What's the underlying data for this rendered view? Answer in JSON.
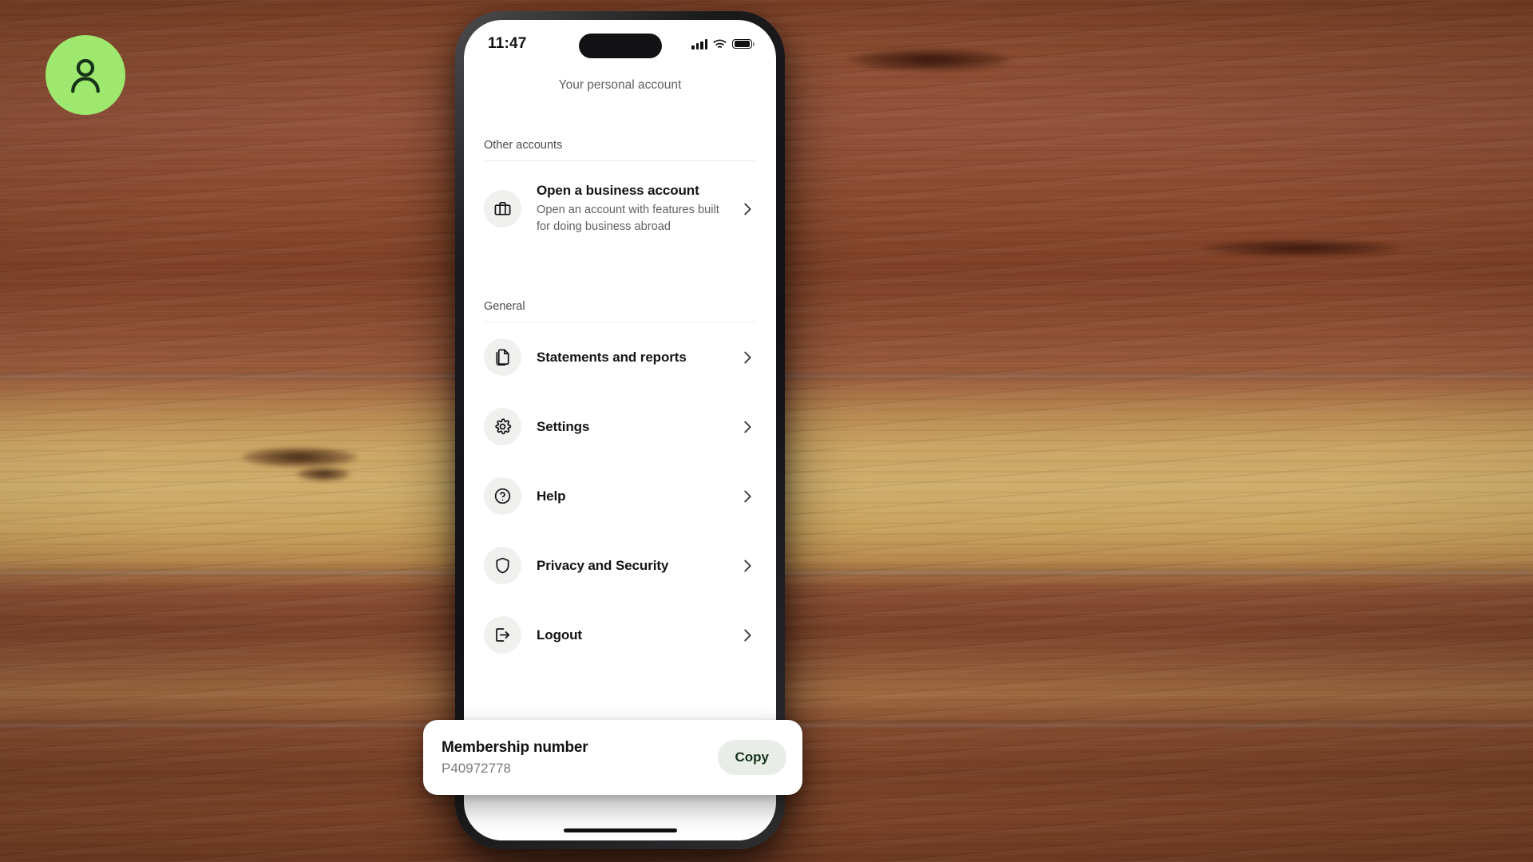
{
  "background": {
    "kind": "wood-desk-photo",
    "description": "Dark reddish-brown hardwood surface with horizontal grain and a lighter tan plank band",
    "colors": {
      "dark_wood": "#8a4a2d",
      "light_plank": "#cfae6b",
      "deep_shadow": "#7a3f25"
    }
  },
  "avatar_badge": {
    "name": "person-avatar",
    "icon": "person-icon",
    "background_color": "#9FE870",
    "icon_color": "#16331a"
  },
  "phone": {
    "status_bar": {
      "time": "11:47",
      "cellular_icon": "signal-bars-icon",
      "wifi_icon": "wifi-icon",
      "battery_icon": "battery-full-icon"
    },
    "home_indicator": "home-indicator"
  },
  "screen": {
    "account_subtitle": "Your personal account",
    "sections": [
      {
        "label": "Other accounts",
        "rows": [
          {
            "icon": "briefcase-icon",
            "title": "Open a business account",
            "subtitle": "Open an account with features built for doing business abroad",
            "chevron": "chevron-right-icon"
          }
        ]
      },
      {
        "label": "General",
        "rows": [
          {
            "icon": "documents-icon",
            "title": "Statements and reports",
            "chevron": "chevron-right-icon"
          },
          {
            "icon": "gear-icon",
            "title": "Settings",
            "chevron": "chevron-right-icon"
          },
          {
            "icon": "question-circle-icon",
            "title": "Help",
            "chevron": "chevron-right-icon"
          },
          {
            "icon": "shield-icon",
            "title": "Privacy and Security",
            "chevron": "chevron-right-icon"
          },
          {
            "icon": "logout-icon",
            "title": "Logout",
            "chevron": "chevron-right-icon"
          }
        ]
      }
    ]
  },
  "membership_card": {
    "title": "Membership number",
    "number": "P40972778",
    "copy_label": "Copy",
    "copy_button_bg": "#e9ede7",
    "copy_button_text_color": "#16331a"
  }
}
